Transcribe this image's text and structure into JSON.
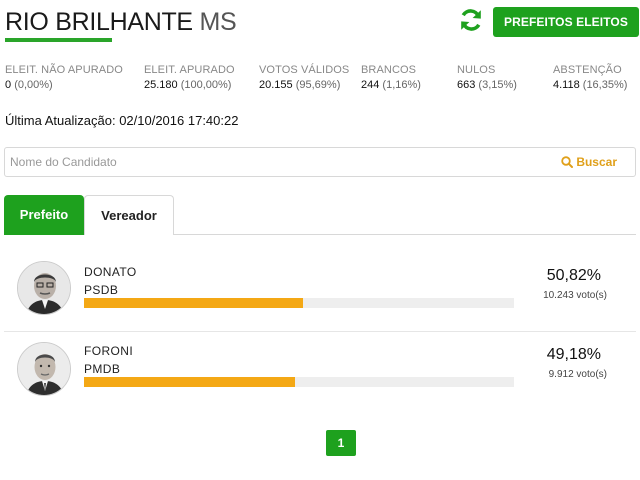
{
  "header": {
    "city": "RIO BRILHANTE",
    "state": "MS",
    "prefeitos_button": "PREFEITOS ELEITOS",
    "accent_color": "#1ea11e"
  },
  "stats": [
    {
      "label": "ELEIT. NÃO APURADO",
      "value": "0",
      "pct": "(0,00%)"
    },
    {
      "label": "ELEIT. APURADO",
      "value": "25.180",
      "pct": "(100,00%)"
    },
    {
      "label": "VOTOS VÁLIDOS",
      "value": "20.155",
      "pct": "(95,69%)"
    },
    {
      "label": "BRANCOS",
      "value": "244",
      "pct": "(1,16%)"
    },
    {
      "label": "NULOS",
      "value": "663",
      "pct": "(3,15%)"
    },
    {
      "label": "ABSTENÇÃO",
      "value": "4.118",
      "pct": "(16,35%)"
    }
  ],
  "last_update": {
    "label": "Última Atualização:",
    "value": "02/10/2016 17:40:22"
  },
  "search": {
    "placeholder": "Nome do Candidato",
    "value": "",
    "button_label": "Buscar"
  },
  "tabs": [
    {
      "label": "Prefeito",
      "active": true
    },
    {
      "label": "Vereador",
      "active": false
    }
  ],
  "candidates": [
    {
      "name": "DONATO",
      "party": "PSDB",
      "percent": "50,82%",
      "votes": "10.243 voto(s)",
      "share": 0.5082
    },
    {
      "name": "FORONI",
      "party": "PMDB",
      "percent": "49,18%",
      "votes": "9.912 voto(s)",
      "share": 0.4918
    }
  ],
  "bar_color": "#f4a815",
  "pagination": {
    "current": "1"
  }
}
